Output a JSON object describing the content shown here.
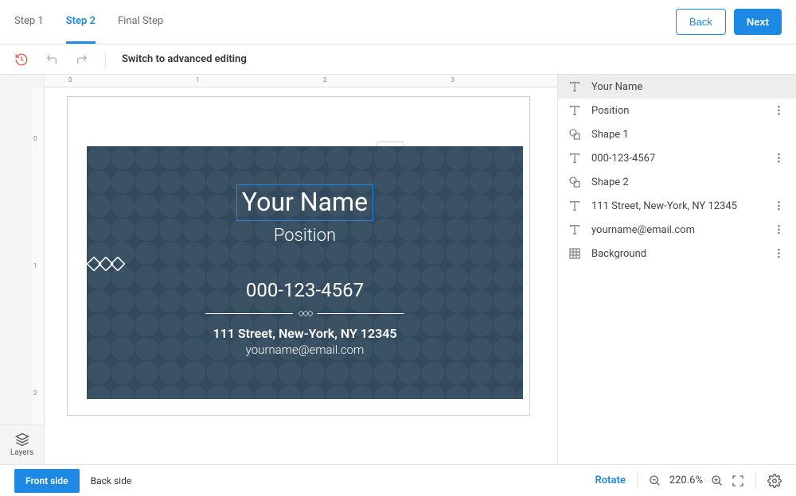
{
  "header": {
    "steps": [
      "Step 1",
      "Step 2",
      "Final Step"
    ],
    "active_step_index": 1,
    "back_label": "Back",
    "next_label": "Next"
  },
  "toolbar": {
    "switch_label": "Switch to advanced editing"
  },
  "canvas": {
    "ruler_h": [
      "0",
      "1",
      "2",
      "3"
    ],
    "ruler_v": [
      "0",
      "1",
      "2"
    ],
    "layers_button": "Layers",
    "card": {
      "name": "Your Name",
      "position": "Position",
      "phone": "000-123-4567",
      "address": "111 Street, New-York, NY 12345",
      "email": "yourname@email.com"
    }
  },
  "layers_panel": {
    "items": [
      {
        "icon": "text",
        "label": "Your Name",
        "menu": false,
        "selected": true
      },
      {
        "icon": "text",
        "label": "Position",
        "menu": true,
        "selected": false
      },
      {
        "icon": "shape",
        "label": "Shape 1",
        "menu": false,
        "selected": false
      },
      {
        "icon": "text",
        "label": "000-123-4567",
        "menu": true,
        "selected": false
      },
      {
        "icon": "shape",
        "label": "Shape 2",
        "menu": false,
        "selected": false
      },
      {
        "icon": "text",
        "label": "111 Street, New-York, NY 12345",
        "menu": true,
        "selected": false
      },
      {
        "icon": "text",
        "label": "yourname@email.com",
        "menu": true,
        "selected": false
      },
      {
        "icon": "background",
        "label": "Background",
        "menu": true,
        "selected": false
      }
    ]
  },
  "footer": {
    "front_label": "Front side",
    "back_label": "Back side",
    "rotate_label": "Rotate",
    "zoom_value": "220.6%"
  }
}
